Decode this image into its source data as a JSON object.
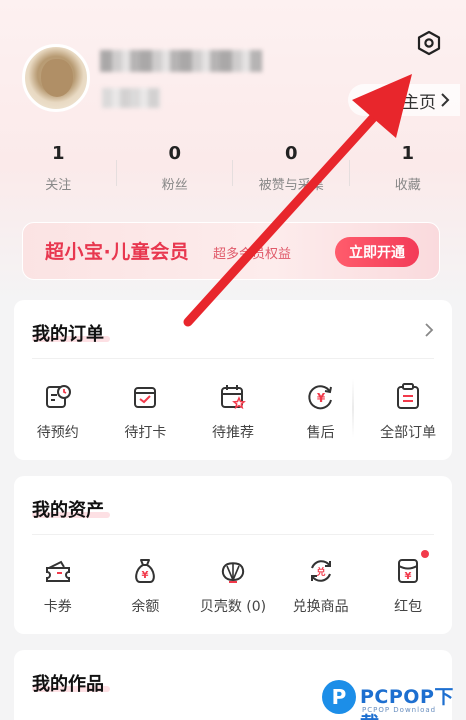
{
  "header": {
    "homepage_label": "主页"
  },
  "stats": [
    {
      "value": "1",
      "label": "关注"
    },
    {
      "value": "0",
      "label": "粉丝"
    },
    {
      "value": "0",
      "label": "被赞与采集"
    },
    {
      "value": "1",
      "label": "收藏"
    }
  ],
  "vip": {
    "title": "超小宝·儿童会员",
    "subtitle": "超多会员权益",
    "button": "立即开通"
  },
  "orders": {
    "title": "我的订单",
    "items": [
      {
        "label": "待预约",
        "icon": "calendar-clock-icon"
      },
      {
        "label": "待打卡",
        "icon": "check-bag-icon"
      },
      {
        "label": "待推荐",
        "icon": "calendar-star-icon"
      },
      {
        "label": "售后",
        "icon": "refund-yen-icon"
      },
      {
        "label": "全部订单",
        "icon": "clipboard-list-icon"
      }
    ]
  },
  "assets": {
    "title": "我的资产",
    "items": [
      {
        "label": "卡券",
        "icon": "ticket-icon"
      },
      {
        "label": "余额",
        "icon": "money-bag-icon"
      },
      {
        "label": "贝壳数 (0)",
        "icon": "shell-icon"
      },
      {
        "label": "兑换商品",
        "icon": "exchange-icon"
      },
      {
        "label": "红包",
        "icon": "red-envelope-icon"
      }
    ]
  },
  "works": {
    "title": "我的作品"
  },
  "watermark": {
    "brand": "PCPOP下载",
    "sub": "PCPOP Download"
  },
  "colors": {
    "accent": "#f23a4b",
    "annotation_arrow": "#e8262c"
  }
}
